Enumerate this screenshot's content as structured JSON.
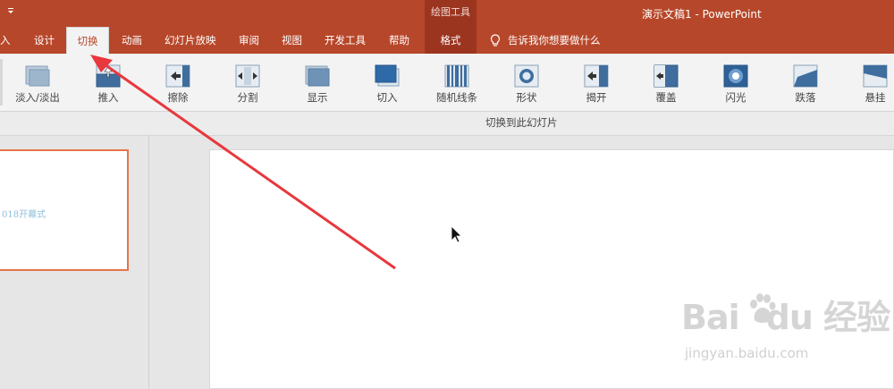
{
  "titlebar": {
    "qat_icon": "customize-qat-chevron-icon",
    "drawing_tools": "绘图工具",
    "window_title": "演示文稿1  -  PowerPoint"
  },
  "tabs": [
    {
      "label": "入",
      "name": "tab-insert"
    },
    {
      "label": "设计",
      "name": "tab-design"
    },
    {
      "label": "切换",
      "name": "tab-transitions",
      "active": true
    },
    {
      "label": "动画",
      "name": "tab-animations"
    },
    {
      "label": "幻灯片放映",
      "name": "tab-slideshow"
    },
    {
      "label": "审阅",
      "name": "tab-review"
    },
    {
      "label": "视图",
      "name": "tab-view"
    },
    {
      "label": "开发工具",
      "name": "tab-developer"
    },
    {
      "label": "帮助",
      "name": "tab-help"
    },
    {
      "label": "格式",
      "name": "tab-format"
    }
  ],
  "tell_me": {
    "icon": "lightbulb-icon",
    "label": "告诉我你想要做什么"
  },
  "transitions": [
    {
      "label": "淡入/淡出",
      "icon": "fade-icon"
    },
    {
      "label": "推入",
      "icon": "push-icon"
    },
    {
      "label": "擦除",
      "icon": "wipe-icon"
    },
    {
      "label": "分割",
      "icon": "split-icon"
    },
    {
      "label": "显示",
      "icon": "reveal-icon"
    },
    {
      "label": "切入",
      "icon": "cut-icon"
    },
    {
      "label": "随机线条",
      "icon": "random-bars-icon"
    },
    {
      "label": "形状",
      "icon": "shape-icon"
    },
    {
      "label": "揭开",
      "icon": "uncover-icon"
    },
    {
      "label": "覆盖",
      "icon": "cover-icon"
    },
    {
      "label": "闪光",
      "icon": "flash-icon"
    },
    {
      "label": "跌落",
      "icon": "fall-over-icon"
    },
    {
      "label": "悬挂",
      "icon": "drape-icon"
    }
  ],
  "group_label": "切换到此幻灯片",
  "thumbnail": {
    "text": "018开幕式"
  },
  "annotation": {
    "arrow_color": "#e8383d"
  },
  "watermark": {
    "logo": "Bai du 经验",
    "url": "jingyan.baidu.com"
  },
  "colors": {
    "accent": "#b7472a",
    "context_tab": "#9b3520"
  }
}
